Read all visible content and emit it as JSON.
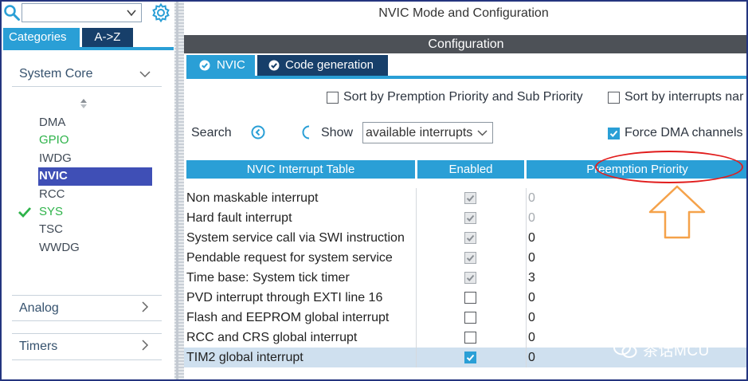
{
  "left": {
    "tabs": {
      "categories": "Categories",
      "az": "A->Z"
    },
    "sections": [
      {
        "label": "System Core",
        "expanded": true
      },
      {
        "label": "Analog",
        "expanded": false
      },
      {
        "label": "Timers",
        "expanded": false
      }
    ],
    "items": [
      {
        "label": "DMA",
        "state": "normal"
      },
      {
        "label": "GPIO",
        "state": "green"
      },
      {
        "label": "IWDG",
        "state": "normal"
      },
      {
        "label": "NVIC",
        "state": "selected"
      },
      {
        "label": "RCC",
        "state": "normal"
      },
      {
        "label": "SYS",
        "state": "checked"
      },
      {
        "label": "TSC",
        "state": "normal"
      },
      {
        "label": "WWDG",
        "state": "normal"
      }
    ]
  },
  "header": {
    "title": "NVIC Mode and Configuration",
    "config_bar": "Configuration",
    "tabs": {
      "nvic": "NVIC",
      "codegen": "Code generation"
    }
  },
  "options": {
    "sort_preemption": {
      "label": "Sort by Premption Priority and Sub Priority",
      "checked": false
    },
    "sort_interrupts": {
      "label": "Sort by interrupts nar",
      "checked": false
    },
    "force_dma": {
      "label": "Force DMA channels",
      "checked": true
    }
  },
  "search": {
    "label": "Search",
    "show_label": "Show",
    "show_value": "available interrupts"
  },
  "table": {
    "headers": {
      "name": "NVIC Interrupt Table",
      "enabled": "Enabled",
      "preemption": "Preemption Priority"
    },
    "rows": [
      {
        "name": "Non maskable interrupt",
        "enabled": true,
        "locked": true,
        "priority": "0",
        "dim": true
      },
      {
        "name": "Hard fault interrupt",
        "enabled": true,
        "locked": true,
        "priority": "0",
        "dim": true
      },
      {
        "name": "System service call via SWI instruction",
        "enabled": true,
        "locked": true,
        "priority": "0",
        "dim": false
      },
      {
        "name": "Pendable request for system service",
        "enabled": true,
        "locked": true,
        "priority": "0",
        "dim": false
      },
      {
        "name": "Time base: System tick timer",
        "enabled": true,
        "locked": true,
        "priority": "3",
        "dim": false
      },
      {
        "name": "PVD interrupt through EXTI line 16",
        "enabled": false,
        "locked": false,
        "priority": "0",
        "dim": false
      },
      {
        "name": "Flash and EEPROM global interrupt",
        "enabled": false,
        "locked": false,
        "priority": "0",
        "dim": false
      },
      {
        "name": "RCC and CRS global interrupt",
        "enabled": false,
        "locked": false,
        "priority": "0",
        "dim": false
      },
      {
        "name": "TIM2 global interrupt",
        "enabled": true,
        "locked": false,
        "priority": "0",
        "dim": false,
        "highlighted": true
      }
    ]
  },
  "watermark": {
    "text": "茶话MCU"
  },
  "colors": {
    "accent": "#2a9fd6",
    "dark_tab": "#173f6a",
    "selected": "#3f4fb6",
    "annotation_red": "#e11d1d",
    "annotation_orange": "#f5a24a"
  }
}
